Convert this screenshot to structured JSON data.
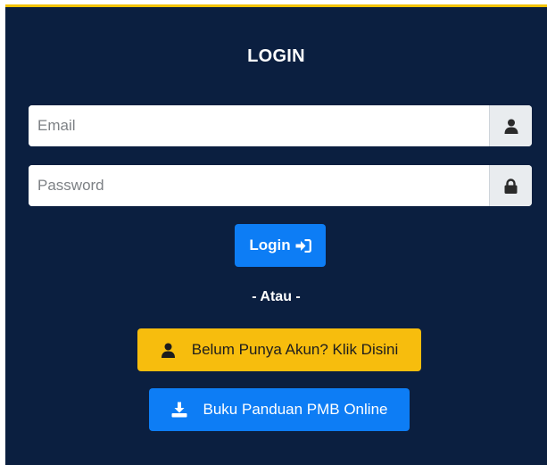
{
  "login": {
    "title": "LOGIN",
    "email_placeholder": "Email",
    "password_placeholder": "Password",
    "submit_label": "Login",
    "divider_text": "- Atau -",
    "register_label": "Belum Punya Akun? Klik Disini",
    "guide_label": "Buku Panduan PMB Online"
  },
  "icons": {
    "email_addon": "user-icon",
    "password_addon": "lock-icon",
    "submit": "sign-in-icon",
    "register": "user-icon",
    "guide": "download-icon"
  },
  "colors": {
    "panel_bg": "#0b1f40",
    "top_border": "#f2c200",
    "primary_button": "#0d7df5",
    "warning_button": "#f7bd0d",
    "addon_bg": "#e9ecef"
  }
}
